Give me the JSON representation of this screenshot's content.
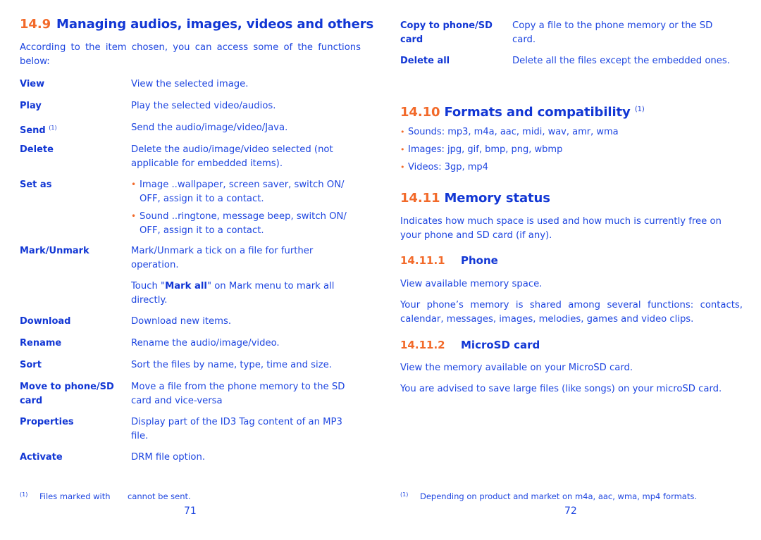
{
  "left_page": {
    "section": {
      "number": "14.9",
      "title": "Managing audios, images, videos and others"
    },
    "intro": "According to the item chosen, you can access some of the functions below:",
    "items": [
      {
        "term": "View",
        "sup": "",
        "desc": "View the selected image."
      },
      {
        "term": "Play",
        "sup": "",
        "desc": "Play the selected video/audios."
      },
      {
        "term": "Send",
        "sup": "(1)",
        "desc": "Send the audio/image/video/Java."
      },
      {
        "term": "Delete",
        "sup": "",
        "desc": "Delete the audio/image/video selected (not applicable for embedded items)."
      },
      {
        "term": "Set as",
        "sup": "",
        "bullets": [
          "Image ..wallpaper, screen saver, switch ON/ OFF, assign it to a contact.",
          "Sound ..ringtone, message beep, switch ON/ OFF, assign it to a contact."
        ]
      },
      {
        "term": "Mark/Unmark",
        "sup": "",
        "desc": "Mark/Unmark a tick on a file for further operation.",
        "extra_pre": "Touch \"",
        "extra_bold": "Mark all",
        "extra_post": "\" on Mark menu to mark all directly."
      },
      {
        "term": "Download",
        "sup": "",
        "desc": "Download new items."
      },
      {
        "term": "Rename",
        "sup": "",
        "desc": "Rename the audio/image/video."
      },
      {
        "term": "Sort",
        "sup": "",
        "desc": "Sort the files by name, type, time and size."
      },
      {
        "term": "Move to phone/SD card",
        "sup": "",
        "desc": "Move a file from the phone memory to the SD card and vice-versa"
      },
      {
        "term": "Properties",
        "sup": "",
        "desc": "Display part of the ID3 Tag content of an MP3 file."
      },
      {
        "term": "Activate",
        "sup": "",
        "desc": "DRM file option."
      }
    ],
    "footnote": {
      "mark": "(1)",
      "text_before": "Files marked with",
      "text_after": "cannot be sent."
    },
    "page_number": "71"
  },
  "right_page": {
    "items": [
      {
        "term": "Copy to phone/SD card",
        "desc": "Copy a file to the phone memory or the SD card."
      },
      {
        "term": "Delete all",
        "desc": "Delete all the files except the embedded ones."
      }
    ],
    "formats": {
      "number": "14.10",
      "title": "Formats and compatibility",
      "sup": "(1)",
      "bullets": [
        "Sounds: mp3, m4a, aac, midi, wav, amr, wma",
        "Images: jpg, gif, bmp, png, wbmp",
        "Videos: 3gp, mp4"
      ]
    },
    "memory": {
      "number": "14.11",
      "title": "Memory status",
      "intro": "Indicates how much space is used and how much is currently free on your phone and SD card (if any).",
      "phone": {
        "number": "14.11.1",
        "title": "Phone",
        "paragraphs": [
          "View available memory space.",
          "Your phone’s memory is shared among several functions: contacts, calendar, messages, images, melodies, games and video clips."
        ]
      },
      "microsd": {
        "number": "14.11.2",
        "title": "MicroSD card",
        "paragraphs": [
          "View the memory available on your MicroSD card.",
          "You are advised to save large files (like songs) on your microSD card."
        ]
      }
    },
    "footnote": {
      "mark": "(1)",
      "text": "Depending on product and market on m4a, aac, wma, mp4 formats."
    },
    "page_number": "72"
  },
  "colors": {
    "accent_orange": "#f26a2a",
    "heading_blue": "#1237d4",
    "text_blue": "#1e46e0"
  }
}
